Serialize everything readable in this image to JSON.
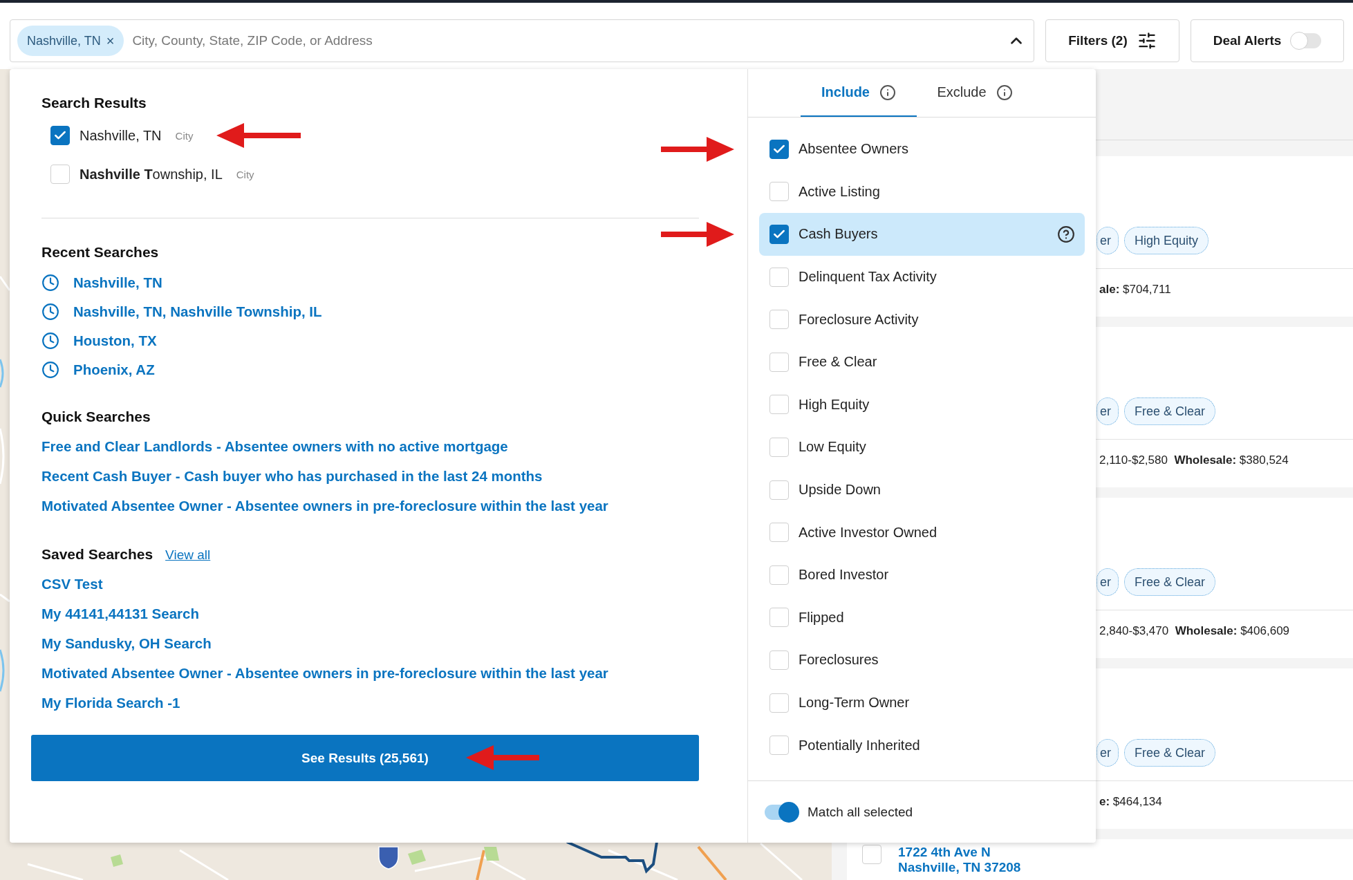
{
  "search_bar": {
    "chips": [
      {
        "label": "Nashville, TN",
        "remove": "×"
      }
    ],
    "placeholder": "City, County, State, ZIP Code, or Address",
    "expanded": true
  },
  "filters_button": {
    "label": "Filters (2)"
  },
  "deal_alerts": {
    "label": "Deal Alerts",
    "on": false
  },
  "search_results": {
    "title": "Search Results",
    "items": [
      {
        "label": "Nashville, TN",
        "type": "City",
        "checked": true,
        "annotated": true
      },
      {
        "label": "**Nashville T**ownship, IL",
        "type": "City",
        "checked": false,
        "annotated": false
      }
    ]
  },
  "recent_searches": {
    "title": "Recent Searches",
    "items": [
      "Nashville, TN",
      "Nashville, TN, Nashville Township, IL",
      "Houston, TX",
      "Phoenix, AZ"
    ]
  },
  "quick_searches": {
    "title": "Quick Searches",
    "items": [
      "Free and Clear Landlords - Absentee owners with no active mortgage",
      "Recent Cash Buyer - Cash buyer who has purchased in the last 24 months",
      "Motivated Absentee Owner - Absentee owners in pre-foreclosure within the last year"
    ]
  },
  "saved_searches": {
    "title": "Saved Searches",
    "view_all": "View all",
    "items": [
      "CSV Test",
      "My 44141,44131 Search",
      "My Sandusky, OH Search",
      "Motivated Absentee Owner - Absentee owners in pre-foreclosure within the last year",
      "My Florida Search -1"
    ]
  },
  "see_results_button": {
    "label": "See Results (25,561)",
    "annotated": true
  },
  "filter_tabs": [
    {
      "label": "Include",
      "selected": true
    },
    {
      "label": "Exclude",
      "selected": false
    }
  ],
  "filter_options": [
    {
      "label": "Absentee Owners",
      "checked": true,
      "highlighted": false,
      "annotated": true
    },
    {
      "label": "Active Listing",
      "checked": false,
      "highlighted": false,
      "annotated": false
    },
    {
      "label": "Cash Buyers",
      "checked": true,
      "highlighted": true,
      "annotated": true
    },
    {
      "label": "Delinquent Tax Activity",
      "checked": false,
      "highlighted": false,
      "annotated": false
    },
    {
      "label": "Foreclosure Activity",
      "checked": false,
      "highlighted": false,
      "annotated": false
    },
    {
      "label": "Free & Clear",
      "checked": false,
      "highlighted": false,
      "annotated": false
    },
    {
      "label": "High Equity",
      "checked": false,
      "highlighted": false,
      "annotated": false
    },
    {
      "label": "Low Equity",
      "checked": false,
      "highlighted": false,
      "annotated": false
    },
    {
      "label": "Upside Down",
      "checked": false,
      "highlighted": false,
      "annotated": false
    },
    {
      "label": "Active Investor Owned",
      "checked": false,
      "highlighted": false,
      "annotated": false
    },
    {
      "label": "Bored Investor",
      "checked": false,
      "highlighted": false,
      "annotated": false
    },
    {
      "label": "Flipped",
      "checked": false,
      "highlighted": false,
      "annotated": false
    },
    {
      "label": "Foreclosures",
      "checked": false,
      "highlighted": false,
      "annotated": false
    },
    {
      "label": "Long-Term Owner",
      "checked": false,
      "highlighted": false,
      "annotated": false
    },
    {
      "label": "Potentially Inherited",
      "checked": false,
      "highlighted": false,
      "annotated": false
    }
  ],
  "match_all": {
    "label": "Match all selected",
    "on": true
  },
  "listings": [
    {
      "tags": [
        "er",
        "High Equity"
      ],
      "details": "**ale:** $704,711"
    },
    {
      "tags": [
        "er",
        "Free & Clear"
      ],
      "details": "2,110-$2,580  **Wholesale:** $380,524"
    },
    {
      "tags": [
        "er",
        "Free & Clear"
      ],
      "details": "2,840-$3,470  **Wholesale:** $406,609"
    },
    {
      "tags": [
        "er",
        "Free & Clear"
      ],
      "details": "**e:** $464,134"
    }
  ],
  "listing_preview": {
    "checked": false,
    "address": "1722 4th Ave N",
    "city": "Nashville, TN 37208"
  }
}
